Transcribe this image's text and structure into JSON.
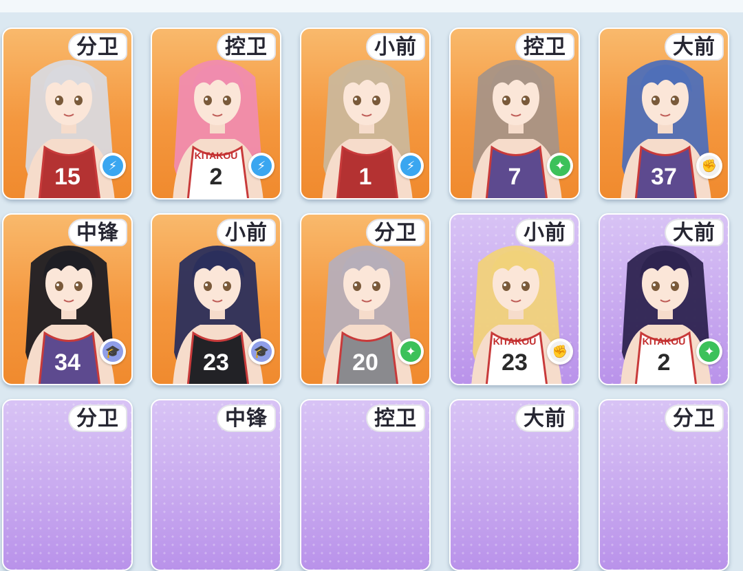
{
  "cards_row1": [
    {
      "role": "分卫",
      "badge": "bolt-icon",
      "theme": "orange",
      "hair": "#d9d9de",
      "jersey": "#b43232",
      "number": "15"
    },
    {
      "role": "控卫",
      "badge": "bolt-icon",
      "theme": "orange",
      "hair": "#f08cae",
      "jersey": "#ffffff",
      "number": "2",
      "jersey_text": "KITAKOU"
    },
    {
      "role": "小前",
      "badge": "bolt-icon",
      "theme": "orange",
      "hair": "#cbb79a",
      "jersey": "#b43232",
      "number": "1"
    },
    {
      "role": "控卫",
      "badge": "star-icon",
      "theme": "orange",
      "hair": "#a89486",
      "jersey": "#5d4a8f",
      "number": "7"
    },
    {
      "role": "大前",
      "badge": "fist-icon",
      "theme": "orange",
      "hair": "#4f6fb8",
      "jersey": "#5d4a8f",
      "number": "37"
    }
  ],
  "cards_row2": [
    {
      "role": "中锋",
      "badge": "cap-icon",
      "theme": "orange",
      "hair": "#1e1e24",
      "jersey": "#5d4a8f",
      "number": "34"
    },
    {
      "role": "小前",
      "badge": "cap-icon",
      "theme": "orange",
      "hair": "#2b2f5c",
      "jersey": "#222226",
      "number": "23"
    },
    {
      "role": "分卫",
      "badge": "star-icon",
      "theme": "orange",
      "hair": "#b6aeb9",
      "jersey": "#8a8a8e",
      "number": "20"
    },
    {
      "role": "小前",
      "badge": "fist-icon",
      "theme": "purple",
      "hair": "#f1d27a",
      "jersey": "#ffffff",
      "number": "23",
      "jersey_text": "KITAKOU"
    },
    {
      "role": "大前",
      "badge": "star-icon",
      "theme": "purple",
      "hair": "#2e2450",
      "jersey": "#ffffff",
      "number": "2",
      "jersey_text": "KITAKOU"
    }
  ],
  "cards_row3": [
    {
      "role": "分卫",
      "theme": "purple"
    },
    {
      "role": "中锋",
      "theme": "purple"
    },
    {
      "role": "控卫",
      "theme": "purple"
    },
    {
      "role": "大前",
      "theme": "purple"
    },
    {
      "role": "分卫",
      "theme": "purple"
    }
  ]
}
